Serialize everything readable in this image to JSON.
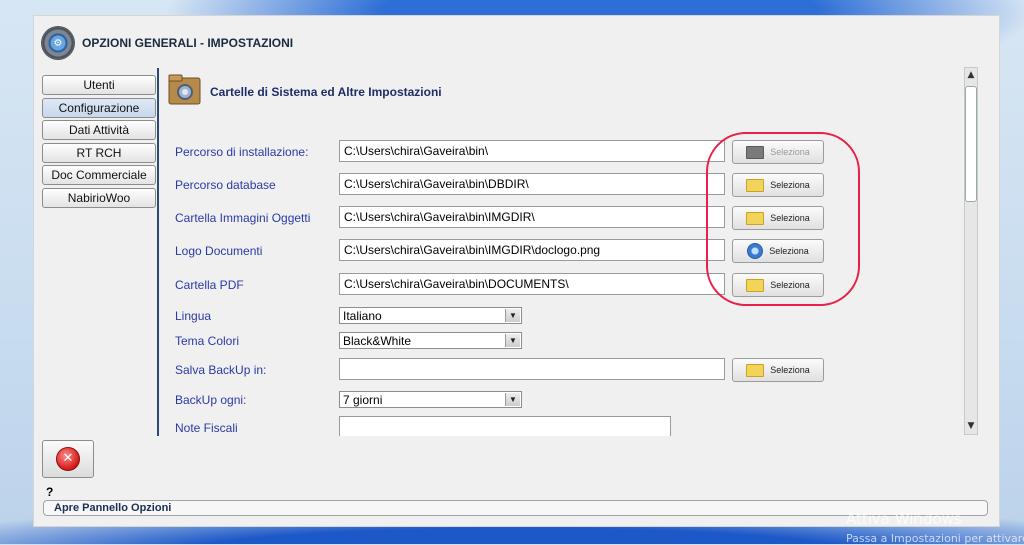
{
  "window": {
    "title": "OPZIONI GENERALI - IMPOSTAZIONI"
  },
  "sidebar": {
    "items": [
      {
        "label": "Utenti",
        "active": false
      },
      {
        "label": "Configurazione",
        "active": true
      },
      {
        "label": "Dati Attività",
        "active": false
      },
      {
        "label": "RT RCH",
        "active": false
      },
      {
        "label": "Doc Commerciale",
        "active": false
      },
      {
        "label": "NabirioWoo",
        "active": false
      }
    ]
  },
  "section": {
    "title": "Cartelle di Sistema ed Altre Impostazioni"
  },
  "fields": [
    {
      "label": "Percorso di installazione:",
      "value": "C:\\Users\\chira\\Gaveira\\bin\\",
      "button": "Seleziona",
      "icon": "folder-icon-gray",
      "enabled": false
    },
    {
      "label": "Percorso database",
      "value": "C:\\Users\\chira\\Gaveira\\bin\\DBDIR\\",
      "button": "Seleziona",
      "icon": "folder-icon",
      "enabled": true
    },
    {
      "label": "Cartella Immagini Oggetti",
      "value": "C:\\Users\\chira\\Gaveira\\bin\\IMGDIR\\",
      "button": "Seleziona",
      "icon": "folder-icon",
      "enabled": true
    },
    {
      "label": "Logo Documenti",
      "value": "C:\\Users\\chira\\Gaveira\\bin\\IMGDIR\\doclogo.png",
      "button": "Seleziona",
      "icon": "globe-icon",
      "enabled": true
    },
    {
      "label": "Cartella PDF",
      "value": "C:\\Users\\chira\\Gaveira\\bin\\DOCUMENTS\\",
      "button": "Seleziona",
      "icon": "folder-icon",
      "enabled": true
    }
  ],
  "lingua": {
    "label": "Lingua",
    "selected": "Italiano"
  },
  "tema": {
    "label": "Tema Colori",
    "selected": "Black&White"
  },
  "backup_path": {
    "label": "Salva BackUp in:",
    "value": "",
    "button": "Seleziona"
  },
  "backup_freq": {
    "label": "BackUp ogni:",
    "selected": "7 giorni"
  },
  "note": {
    "label": "Note Fiscali",
    "value": ""
  },
  "help": {
    "text": "?"
  },
  "status": {
    "text": "Apre Pannello Opzioni"
  },
  "watermark": {
    "line1": "Attiva Windows",
    "line2": "Passa a Impostazioni per attivare"
  },
  "colors": {
    "annotation": "#e8204a",
    "label": "#2b3aa6",
    "title": "#1f2d66"
  }
}
